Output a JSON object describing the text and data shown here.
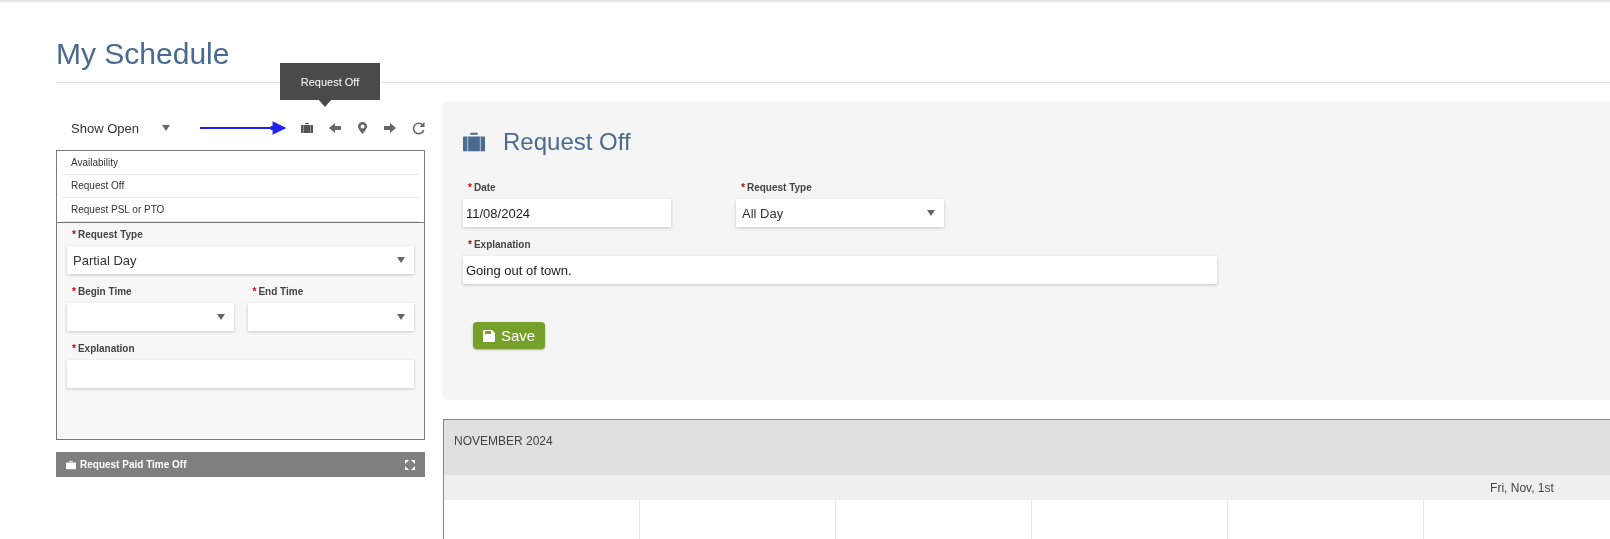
{
  "page_title": "My Schedule",
  "toolbar": {
    "filter": "Show Open",
    "tooltip": "Request Off",
    "buttons": [
      {
        "kind": "suitcase",
        "highlighted": true
      },
      {
        "kind": "back",
        "highlighted": false
      },
      {
        "kind": "pin",
        "highlighted": false
      },
      {
        "kind": "forward",
        "highlighted": false
      },
      {
        "kind": "refresh",
        "highlighted": false
      }
    ]
  },
  "menu": {
    "items": [
      "Availability",
      "Request Off",
      "Request PSL or PTO"
    ]
  },
  "left_form": {
    "request_type_label": {
      "mark": "*",
      "text": "Request Type"
    },
    "request_type": "Partial Day",
    "begin_time_label": {
      "mark": "*",
      "text": "Begin Time"
    },
    "end_time_label": {
      "mark": "*",
      "text": "End Time"
    },
    "explanation_label": {
      "mark": "*",
      "text": "Explanation"
    }
  },
  "collapsed_bar": {
    "title": "Request Paid Time Off"
  },
  "request_card": {
    "title": "Request Off",
    "date_label": {
      "mark": "*",
      "text": "Date"
    },
    "date": "11/08/2024",
    "request_type_label": {
      "mark": "*",
      "text": "Request Type"
    },
    "request_type": "All Day",
    "explanation_label": {
      "mark": "*",
      "text": "Explanation"
    },
    "explanation": "Going out of town.",
    "save": "Save"
  },
  "calendar": {
    "month": "NOVEMBER 2024",
    "day_header": "Fri, Nov, 1st"
  }
}
